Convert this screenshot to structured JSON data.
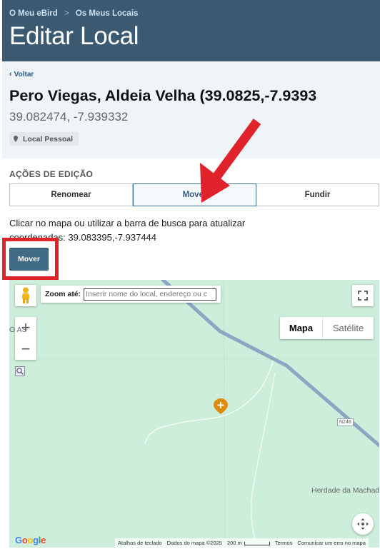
{
  "header": {
    "breadcrumb": [
      "O Meu eBird",
      "Os Meus Locais"
    ],
    "breadcrumb_separator": ">",
    "title": "Editar Local"
  },
  "location": {
    "back_label": "Voltar",
    "name": "Pero Viegas, Aldeia Velha (39.0825,-7.9393",
    "coords": "39.082474, -7.939332",
    "badge": "Local Pessoal"
  },
  "edit_actions": {
    "section_label": "AÇÕES DE EDIÇÃO",
    "tabs": [
      {
        "label": "Renomear",
        "active": false
      },
      {
        "label": "Mover",
        "active": true
      },
      {
        "label": "Fundir",
        "active": false
      }
    ],
    "instruction": "Clicar no mapa ou utilizar a barra de busca para atualizar coordenadas: 39.083395,-7.937444",
    "move_button": "Mover"
  },
  "map": {
    "zoom_label": "Zoom até:",
    "zoom_placeholder": "Inserir nome do local, endereço ou c",
    "map_type_options": [
      "Mapa",
      "Satélite"
    ],
    "map_type_selected": "Mapa",
    "zoom_in": "+",
    "zoom_out": "−",
    "labels": {
      "place_left": "O  AS",
      "place_right": "Herdade da Machad",
      "road": "N248"
    },
    "logo": "Google",
    "attribution": {
      "keyboard": "Atalhos de teclado",
      "data": "Dados do mapa ©2025",
      "scale": "200 m",
      "terms": "Termos",
      "report": "Comunicar um erro no mapa"
    }
  },
  "colors": {
    "header_bg": "#3b5a72",
    "info_bg": "#eef4f8",
    "accent": "#3f6b87",
    "highlight": "#e0232a",
    "map_bg": "#cdeedb",
    "road": "#8aa7c4",
    "marker": "#e08a0b"
  },
  "icons": [
    "chevron-left-icon",
    "pin-icon",
    "pegman-icon",
    "fullscreen-icon",
    "zoom-search-icon",
    "map-marker-icon",
    "recenter-icon",
    "red-arrow-annotation"
  ]
}
